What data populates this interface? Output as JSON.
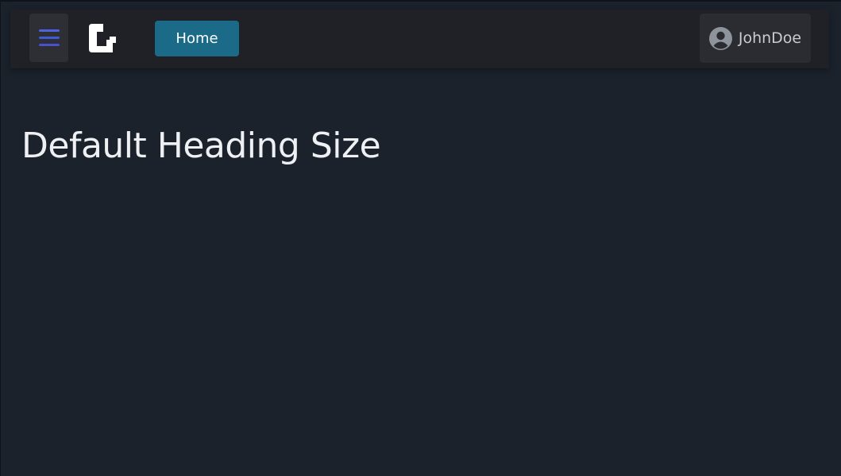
{
  "navbar": {
    "menu_icon": "hamburger-menu-icon",
    "menu_bar_colors": [
      "#4f62e0",
      "#3f5bd9",
      "#4b4fcf"
    ],
    "logo_icon": "app-logo-icon",
    "home_label": "Home",
    "user": {
      "name": "JohnDoe",
      "icon": "user-circle-icon"
    }
  },
  "main": {
    "heading": "Default Heading Size"
  },
  "colors": {
    "page_bg": "#1b222c",
    "navbar_bg": "#202126",
    "home_button_bg": "#1b6a87",
    "heading_text": "#eef0f3",
    "user_text": "#c9cbd1",
    "avatar": "#8e949c"
  }
}
